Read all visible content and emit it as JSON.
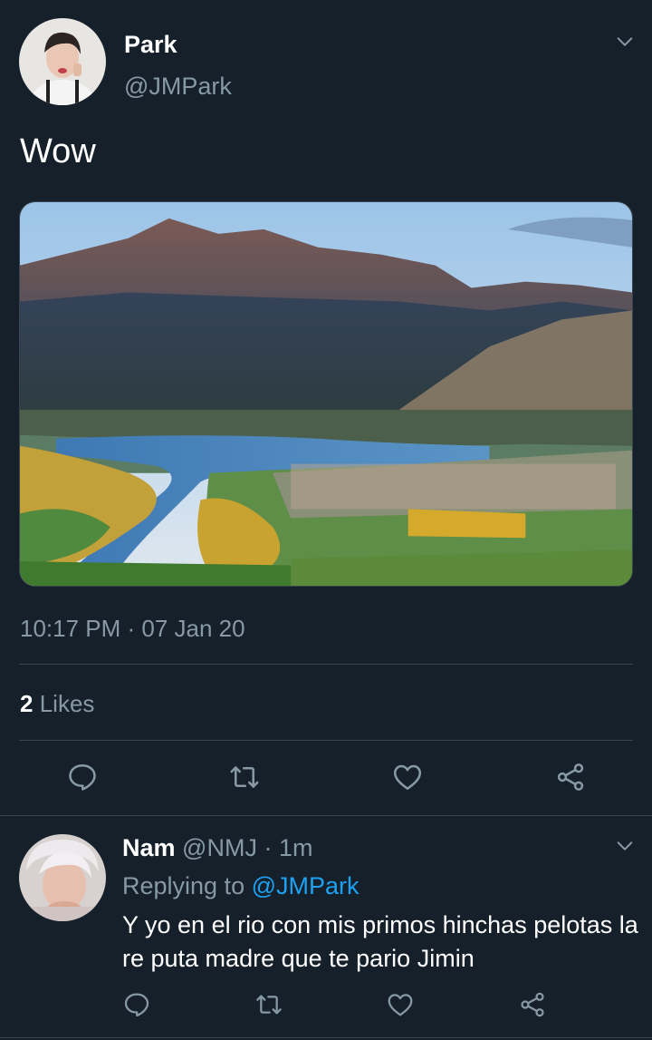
{
  "tweet": {
    "author_name": "Park",
    "author_handle": "@JMPark",
    "text": "Wow",
    "timestamp": "10:17 PM · 07 Jan 20",
    "likes_count": "2",
    "likes_label": "Likes",
    "avatar_icon": "user-photo",
    "media_description_icon": "landscape-photo",
    "menu_icon": "chevron-down-icon"
  },
  "actions": {
    "icons": [
      "reply-icon",
      "retweet-icon",
      "like-icon",
      "share-icon"
    ]
  },
  "reply": {
    "author_name": "Nam",
    "author_handle": "@NMJ",
    "separator": "·",
    "time": "1m",
    "replying_prefix": "Replying to",
    "replying_to": "@JMPark",
    "text": "Y yo en el rio con mis primos hinchas pelotas la re puta madre que te pario Jimin",
    "avatar_icon": "user-photo",
    "menu_icon": "chevron-down-icon"
  },
  "colors": {
    "background": "#15202b",
    "divider": "#38444d",
    "muted_text": "#8899a6",
    "link": "#1da1f2",
    "primary_text": "#ffffff"
  }
}
